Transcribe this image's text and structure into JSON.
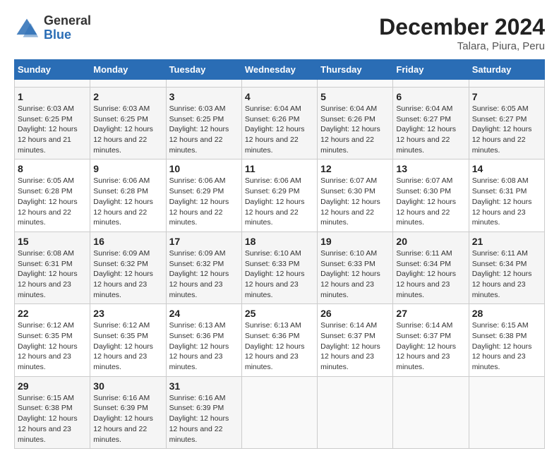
{
  "header": {
    "logo_general": "General",
    "logo_blue": "Blue",
    "main_title": "December 2024",
    "subtitle": "Talara, Piura, Peru"
  },
  "calendar": {
    "days_of_week": [
      "Sunday",
      "Monday",
      "Tuesday",
      "Wednesday",
      "Thursday",
      "Friday",
      "Saturday"
    ],
    "weeks": [
      [
        {
          "day": "",
          "info": ""
        },
        {
          "day": "",
          "info": ""
        },
        {
          "day": "",
          "info": ""
        },
        {
          "day": "",
          "info": ""
        },
        {
          "day": "",
          "info": ""
        },
        {
          "day": "",
          "info": ""
        },
        {
          "day": "",
          "info": ""
        }
      ],
      [
        {
          "day": "1",
          "sunrise": "6:03 AM",
          "sunset": "6:25 PM",
          "daylight": "12 hours and 21 minutes."
        },
        {
          "day": "2",
          "sunrise": "6:03 AM",
          "sunset": "6:25 PM",
          "daylight": "12 hours and 22 minutes."
        },
        {
          "day": "3",
          "sunrise": "6:03 AM",
          "sunset": "6:25 PM",
          "daylight": "12 hours and 22 minutes."
        },
        {
          "day": "4",
          "sunrise": "6:04 AM",
          "sunset": "6:26 PM",
          "daylight": "12 hours and 22 minutes."
        },
        {
          "day": "5",
          "sunrise": "6:04 AM",
          "sunset": "6:26 PM",
          "daylight": "12 hours and 22 minutes."
        },
        {
          "day": "6",
          "sunrise": "6:04 AM",
          "sunset": "6:27 PM",
          "daylight": "12 hours and 22 minutes."
        },
        {
          "day": "7",
          "sunrise": "6:05 AM",
          "sunset": "6:27 PM",
          "daylight": "12 hours and 22 minutes."
        }
      ],
      [
        {
          "day": "8",
          "sunrise": "6:05 AM",
          "sunset": "6:28 PM",
          "daylight": "12 hours and 22 minutes."
        },
        {
          "day": "9",
          "sunrise": "6:06 AM",
          "sunset": "6:28 PM",
          "daylight": "12 hours and 22 minutes."
        },
        {
          "day": "10",
          "sunrise": "6:06 AM",
          "sunset": "6:29 PM",
          "daylight": "12 hours and 22 minutes."
        },
        {
          "day": "11",
          "sunrise": "6:06 AM",
          "sunset": "6:29 PM",
          "daylight": "12 hours and 22 minutes."
        },
        {
          "day": "12",
          "sunrise": "6:07 AM",
          "sunset": "6:30 PM",
          "daylight": "12 hours and 22 minutes."
        },
        {
          "day": "13",
          "sunrise": "6:07 AM",
          "sunset": "6:30 PM",
          "daylight": "12 hours and 22 minutes."
        },
        {
          "day": "14",
          "sunrise": "6:08 AM",
          "sunset": "6:31 PM",
          "daylight": "12 hours and 23 minutes."
        }
      ],
      [
        {
          "day": "15",
          "sunrise": "6:08 AM",
          "sunset": "6:31 PM",
          "daylight": "12 hours and 23 minutes."
        },
        {
          "day": "16",
          "sunrise": "6:09 AM",
          "sunset": "6:32 PM",
          "daylight": "12 hours and 23 minutes."
        },
        {
          "day": "17",
          "sunrise": "6:09 AM",
          "sunset": "6:32 PM",
          "daylight": "12 hours and 23 minutes."
        },
        {
          "day": "18",
          "sunrise": "6:10 AM",
          "sunset": "6:33 PM",
          "daylight": "12 hours and 23 minutes."
        },
        {
          "day": "19",
          "sunrise": "6:10 AM",
          "sunset": "6:33 PM",
          "daylight": "12 hours and 23 minutes."
        },
        {
          "day": "20",
          "sunrise": "6:11 AM",
          "sunset": "6:34 PM",
          "daylight": "12 hours and 23 minutes."
        },
        {
          "day": "21",
          "sunrise": "6:11 AM",
          "sunset": "6:34 PM",
          "daylight": "12 hours and 23 minutes."
        }
      ],
      [
        {
          "day": "22",
          "sunrise": "6:12 AM",
          "sunset": "6:35 PM",
          "daylight": "12 hours and 23 minutes."
        },
        {
          "day": "23",
          "sunrise": "6:12 AM",
          "sunset": "6:35 PM",
          "daylight": "12 hours and 23 minutes."
        },
        {
          "day": "24",
          "sunrise": "6:13 AM",
          "sunset": "6:36 PM",
          "daylight": "12 hours and 23 minutes."
        },
        {
          "day": "25",
          "sunrise": "6:13 AM",
          "sunset": "6:36 PM",
          "daylight": "12 hours and 23 minutes."
        },
        {
          "day": "26",
          "sunrise": "6:14 AM",
          "sunset": "6:37 PM",
          "daylight": "12 hours and 23 minutes."
        },
        {
          "day": "27",
          "sunrise": "6:14 AM",
          "sunset": "6:37 PM",
          "daylight": "12 hours and 23 minutes."
        },
        {
          "day": "28",
          "sunrise": "6:15 AM",
          "sunset": "6:38 PM",
          "daylight": "12 hours and 23 minutes."
        }
      ],
      [
        {
          "day": "29",
          "sunrise": "6:15 AM",
          "sunset": "6:38 PM",
          "daylight": "12 hours and 23 minutes."
        },
        {
          "day": "30",
          "sunrise": "6:16 AM",
          "sunset": "6:39 PM",
          "daylight": "12 hours and 22 minutes."
        },
        {
          "day": "31",
          "sunrise": "6:16 AM",
          "sunset": "6:39 PM",
          "daylight": "12 hours and 22 minutes."
        },
        {
          "day": "",
          "info": ""
        },
        {
          "day": "",
          "info": ""
        },
        {
          "day": "",
          "info": ""
        },
        {
          "day": "",
          "info": ""
        }
      ]
    ]
  }
}
